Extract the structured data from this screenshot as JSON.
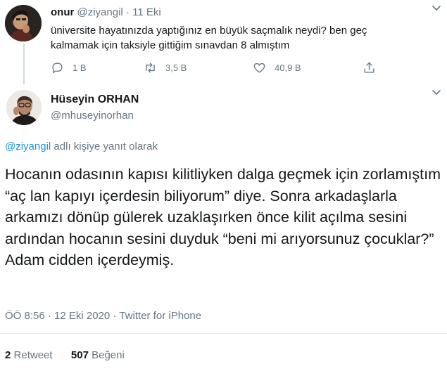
{
  "parent_tweet": {
    "name": "onur",
    "handle": "@ziyangil",
    "separator": "·",
    "date": "11 Eki",
    "text": "üniversite hayatınızda yaptığınız en büyük saçmalık neydi? ben geç kalmamak için taksiyle gittiğim sınavdan 8 almıştım",
    "actions": {
      "reply_count": "1 B",
      "retweet_count": "3,5 B",
      "like_count": "40,9 B"
    }
  },
  "reply_tweet": {
    "name": "Hüseyin ORHAN",
    "handle": "@mhuseyinorhan",
    "replying_mention": "@ziyangil",
    "replying_suffix": " adlı kişiye yanıt olarak",
    "text": "Hocanın odasının kapısı kilitliyken dalga geçmek için zorlamıştım “aç lan kapıyı içerdesin biliyorum” diye. Sonra arkadaşlarla arkamızı dönüp gülerek uzaklaşırken önce kilit açılma sesini ardından hocanın sesini duyduk “beni mi arıyorsunuz çocuklar?” Adam cidden içerdeymiş.",
    "time": "ÖÖ 8:56",
    "date": "12 Eki 2020",
    "source": "Twitter for iPhone",
    "separator": "·",
    "stats": {
      "retweet_count": "2",
      "retweet_label": "Retweet",
      "like_count": "507",
      "like_label": "Beğeni"
    }
  },
  "icons": {
    "reply": "reply-bubble-icon",
    "retweet": "retweet-icon",
    "like": "heart-icon",
    "share": "share-icon",
    "more": "chevron-down-icon"
  },
  "colors": {
    "text": "#14171a",
    "secondary": "#657786",
    "link": "#1b95e0",
    "thread_line": "#cfd9de"
  }
}
